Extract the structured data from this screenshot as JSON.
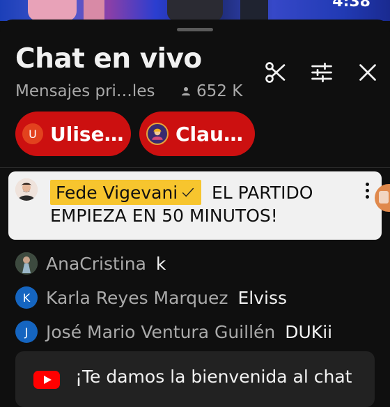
{
  "video": {
    "timer": "4:38"
  },
  "chat": {
    "title": "Chat en vivo",
    "subtitle": "Mensajes pri…les",
    "viewer_count": "652 K"
  },
  "chips": [
    {
      "label": "Ulise…",
      "initial": "U",
      "avatar_color": "#e2421e"
    },
    {
      "label": "Clau…",
      "initial": "",
      "avatar_color": "#3a2a70"
    }
  ],
  "pinned": {
    "author": "Fede Vigevani",
    "message": "EL PARTIDO EMPIEZA EN 50 MINUTOS!"
  },
  "messages": [
    {
      "initial": "",
      "name": "AnaCristina",
      "text": "k",
      "avatar_color": "#5b6b5a"
    },
    {
      "initial": "K",
      "name": "Karla Reyes Marquez",
      "text": "Elviss",
      "avatar_color": "#1565c0"
    },
    {
      "initial": "J",
      "name": "José Mario Ventura Guillén",
      "text": "DUKii",
      "avatar_color": "#1565c0"
    }
  ],
  "welcome": {
    "text": "¡Te damos la bienvenida al chat"
  },
  "icons": [
    "scissors-icon",
    "tune-icon",
    "close-icon",
    "person-icon",
    "verified-check-icon",
    "more-vert-icon",
    "youtube-logo-icon"
  ]
}
